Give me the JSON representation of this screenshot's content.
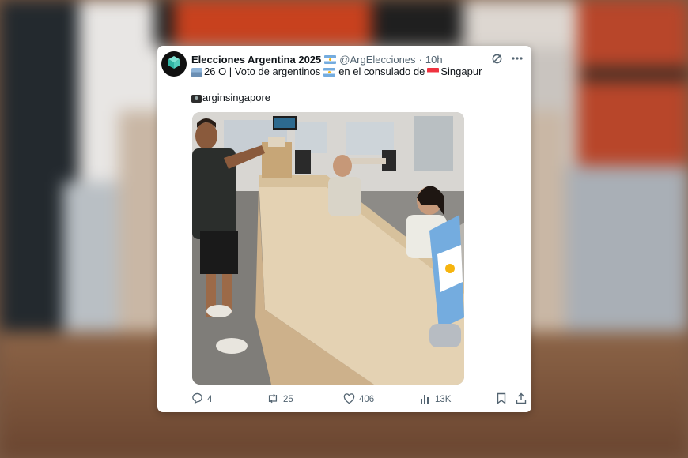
{
  "tweet": {
    "author_name": "Elecciones Argentina 2025",
    "handle": "@ArgElecciones",
    "separator": "·",
    "time": "10h",
    "text_part1": "26 O | Voto de argentinos",
    "text_part2": "en el consulado de",
    "text_part3": "Singapur",
    "caption": "arginsingapore",
    "photo_alt": "Hombre depositando voto en urna en el consulado de Singapur",
    "stats": {
      "replies": "4",
      "retweets": "25",
      "likes": "406",
      "views": "13K"
    }
  },
  "icons": {
    "avatar": "cube-logo-icon",
    "grok": "grok-icon",
    "more": "more-icon",
    "reply": "reply-icon",
    "retweet": "retweet-icon",
    "like": "heart-icon",
    "views": "views-icon",
    "bookmark": "bookmark-icon",
    "share": "share-icon"
  },
  "colors": {
    "text_primary": "#0f1419",
    "text_secondary": "#536471",
    "card_bg": "#ffffff"
  }
}
